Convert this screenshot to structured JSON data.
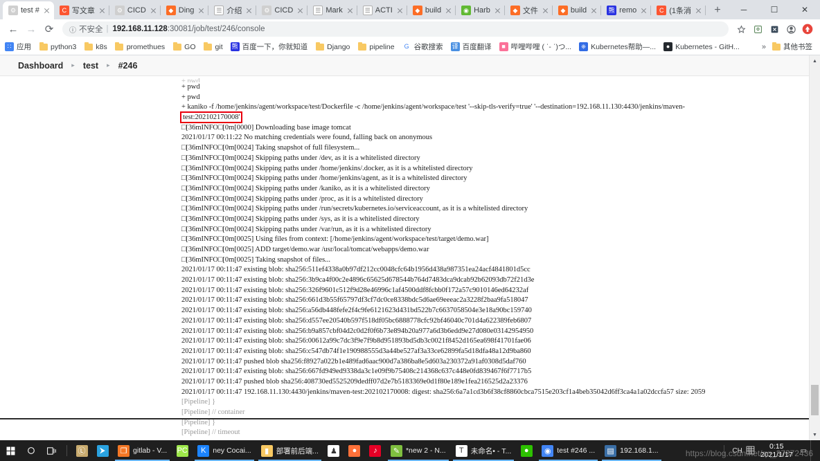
{
  "browser": {
    "tabs": [
      {
        "label": "test #",
        "icon": "jenkins-icon",
        "icon_color": "#cfcfcf",
        "glyph": "⚙",
        "active": true
      },
      {
        "label": "写文章",
        "icon": "csdn-icon",
        "icon_color": "#fc5531",
        "glyph": "C",
        "active": false
      },
      {
        "label": "CICD",
        "icon": "jenkins-icon",
        "icon_color": "#cfcfcf",
        "glyph": "⚙",
        "active": false
      },
      {
        "label": "Ding",
        "icon": "gitlab-icon",
        "icon_color": "#fc6d26",
        "glyph": "◆",
        "active": false
      },
      {
        "label": "介绍",
        "icon": "doc-icon",
        "icon_color": "#ffffff",
        "glyph": "☰",
        "active": false
      },
      {
        "label": "CICD",
        "icon": "jenkins-icon",
        "icon_color": "#cfcfcf",
        "glyph": "⚙",
        "active": false
      },
      {
        "label": "Mark",
        "icon": "doc-icon",
        "icon_color": "#ffffff",
        "glyph": "☰",
        "active": false
      },
      {
        "label": "ACTI",
        "icon": "doc-icon",
        "icon_color": "#ffffff",
        "glyph": "☰",
        "active": false
      },
      {
        "label": "build",
        "icon": "gitlab-icon",
        "icon_color": "#fc6d26",
        "glyph": "◆",
        "active": false
      },
      {
        "label": "Harb",
        "icon": "harbor-icon",
        "icon_color": "#60b932",
        "glyph": "◉",
        "active": false
      },
      {
        "label": "文件",
        "icon": "gitlab-icon",
        "icon_color": "#fc6d26",
        "glyph": "◆",
        "active": false
      },
      {
        "label": "build",
        "icon": "gitlab-icon",
        "icon_color": "#fc6d26",
        "glyph": "◆",
        "active": false
      },
      {
        "label": "remo",
        "icon": "baidu-icon",
        "icon_color": "#2932e1",
        "glyph": "熊",
        "active": false
      },
      {
        "label": "(1条消",
        "icon": "csdn-icon",
        "icon_color": "#fc5531",
        "glyph": "C",
        "active": false
      }
    ],
    "newtab_label": "+",
    "window_controls": {
      "minimize": "─",
      "maximize": "☐",
      "close": "✕"
    },
    "nav": {
      "back": "←",
      "forward": "→",
      "reload": "⟳"
    },
    "omnibox": {
      "security_icon": "ⓘ",
      "security_label": "不安全",
      "separator": "|",
      "host": "192.168.11.128",
      "path": ":30081/job/test/246/console"
    },
    "toolbar_icons": [
      {
        "name": "bookmark-star-icon",
        "glyph": "☆"
      },
      {
        "name": "extension-icon",
        "glyph": "⎇"
      },
      {
        "name": "extension2-icon",
        "glyph": "☒"
      },
      {
        "name": "profile-icon",
        "glyph": "●"
      },
      {
        "name": "update-icon",
        "glyph": "●"
      }
    ],
    "bookmarks": [
      {
        "label": "应用",
        "icon": "apps-grid-icon"
      },
      {
        "label": "python3",
        "icon": "folder-icon"
      },
      {
        "label": "k8s",
        "icon": "folder-icon"
      },
      {
        "label": "promethues",
        "icon": "folder-icon"
      },
      {
        "label": "GO",
        "icon": "folder-icon"
      },
      {
        "label": "git",
        "icon": "folder-icon"
      },
      {
        "label": "百度一下，你就知道",
        "icon": "baidu-icon"
      },
      {
        "label": "Django",
        "icon": "folder-icon"
      },
      {
        "label": "pipeline",
        "icon": "folder-icon"
      },
      {
        "label": "谷歌搜索",
        "icon": "google-icon"
      },
      {
        "label": "百度翻译",
        "icon": "translate-icon"
      },
      {
        "label": "哔哩哔哩 ( ˈ- ˈ)つ...",
        "icon": "bilibili-icon"
      },
      {
        "label": "Kubernetes帮助—...",
        "icon": "kubernetes-icon"
      },
      {
        "label": "Kubernetes - GitH...",
        "icon": "github-icon"
      }
    ],
    "bookmarks_overflow": "»",
    "other_bookmarks": {
      "label": "其他书签",
      "icon": "folder-icon"
    }
  },
  "jenkins": {
    "breadcrumb": [
      {
        "label": "Dashboard"
      },
      {
        "label": "test"
      },
      {
        "label": "#246"
      }
    ],
    "breadcrumb_separator": "▸",
    "highlight_color": "#e8000d",
    "console_lines": [
      {
        "text": "+ pwd",
        "style": "cut"
      },
      {
        "text": "+ pwd",
        "style": "normal"
      },
      {
        "text": "+ pwd",
        "style": "normal"
      },
      {
        "text": "+ kaniko -f /home/jenkins/agent/workspace/test/Dockerfile -c /home/jenkins/agent/workspace/test '--skip-tls-verify=true' '--destination=192.168.11.130:4430/jenkins/maven-",
        "style": "normal"
      },
      {
        "text": "test:202102170008'",
        "style": "highlight"
      },
      {
        "text": "□[36mINFO□[0m[0000] Downloading base image tomcat",
        "style": "normal"
      },
      {
        "text": "2021/01/17 00:11:22 No matching credentials were found, falling back on anonymous",
        "style": "normal"
      },
      {
        "text": "□[36mINFO□[0m[0024] Taking snapshot of full filesystem...",
        "style": "normal"
      },
      {
        "text": "□[36mINFO□[0m[0024] Skipping paths under /dev, as it is a whitelisted directory",
        "style": "normal"
      },
      {
        "text": "□[36mINFO□[0m[0024] Skipping paths under /home/jenkins/.docker, as it is a whitelisted directory",
        "style": "normal"
      },
      {
        "text": "□[36mINFO□[0m[0024] Skipping paths under /home/jenkins/agent, as it is a whitelisted directory",
        "style": "normal"
      },
      {
        "text": "□[36mINFO□[0m[0024] Skipping paths under /kaniko, as it is a whitelisted directory",
        "style": "normal"
      },
      {
        "text": "□[36mINFO□[0m[0024] Skipping paths under /proc, as it is a whitelisted directory",
        "style": "normal"
      },
      {
        "text": "□[36mINFO□[0m[0024] Skipping paths under /run/secrets/kubernetes.io/serviceaccount, as it is a whitelisted directory",
        "style": "normal"
      },
      {
        "text": "□[36mINFO□[0m[0024] Skipping paths under /sys, as it is a whitelisted directory",
        "style": "normal"
      },
      {
        "text": "□[36mINFO□[0m[0024] Skipping paths under /var/run, as it is a whitelisted directory",
        "style": "normal"
      },
      {
        "text": "□[36mINFO□[0m[0025] Using files from context: [/home/jenkins/agent/workspace/test/target/demo.war]",
        "style": "normal"
      },
      {
        "text": "□[36mINFO□[0m[0025] ADD target/demo.war /usr/local/tomcat/webapps/demo.war",
        "style": "normal"
      },
      {
        "text": "□[36mINFO□[0m[0025] Taking snapshot of files...",
        "style": "normal"
      },
      {
        "text": "2021/01/17 00:11:47 existing blob: sha256:511ef4338a0b97df212cc0048cfc64b1956d438a987351ea24acf4841801d5cc",
        "style": "normal"
      },
      {
        "text": "2021/01/17 00:11:47 existing blob: sha256:3b9ca4f00c2e4896c65625d678544b764d7483dca9dcab92b62093db72f21d3e",
        "style": "normal"
      },
      {
        "text": "2021/01/17 00:11:47 existing blob: sha256:326f9601c512f9d28e46996c1af4500ddf8fcbb0f172a57c9010146ed64232af",
        "style": "normal"
      },
      {
        "text": "2021/01/17 00:11:47 existing blob: sha256:661d3b55f65797df3cf7dc0ce8338bdc5d6ae69eeeac2a3228f2baa9fa518047",
        "style": "normal"
      },
      {
        "text": "2021/01/17 00:11:47 existing blob: sha256:a56db448fefe2f4c9fe6121623d431bd522b7c6637058504e3e18a90bc159740",
        "style": "normal"
      },
      {
        "text": "2021/01/17 00:11:47 existing blob: sha256:d557ee20540b597f518df05bc6888778cfc92bf46040c701d4a622389feb6807",
        "style": "normal"
      },
      {
        "text": "2021/01/17 00:11:47 existing blob: sha256:b9a857cbf04d2c0d2f0f6b73e894b20a977a6d3b6edd9e27d080e03142954950",
        "style": "normal"
      },
      {
        "text": "2021/01/17 00:11:47 existing blob: sha256:00612a99c7dc3f9e7f9b8d951893bd5db3c0021f8452d165ea698f41701fae06",
        "style": "normal"
      },
      {
        "text": "2021/01/17 00:11:47 existing blob: sha256:c547db74f1e190988555d3a44be527af3a33ce62899fa5d18dfa48a12d9ba860",
        "style": "normal"
      },
      {
        "text": "2021/01/17 00:11:47 pushed blob sha256:f8927a022b1e489fad6aac900d7a386ba8e5d603a230372a91af0308d5daf760",
        "style": "normal"
      },
      {
        "text": "2021/01/17 00:11:47 existing blob: sha256:667fd949ed9338da3c1e09f9b75408c214368c637c448e0fd839467f6f7717b5",
        "style": "normal"
      },
      {
        "text": "2021/01/17 00:11:47 pushed blob sha256:408730ed5525209dedff07d2e7b5183369e0d1f80e189e1fea216525d2a23376",
        "style": "normal"
      },
      {
        "text": "2021/01/17 00:11:47 192.168.11.130:4430/jenkins/maven-test:202102170008: digest: sha256:6a7a1cd3b6f38cf8860cbca7515e203cf1a4beb35042d6ff3ca4a1a02dccfa57 size: 2059",
        "style": "normal"
      },
      {
        "text": "[Pipeline] }",
        "style": "dim"
      },
      {
        "text": "[Pipeline] // container",
        "style": "dim"
      },
      {
        "text": "[Pipeline] }",
        "style": "dim"
      },
      {
        "text": "[Pipeline] // timeout",
        "style": "dim"
      }
    ]
  },
  "scrollbar": {
    "up_arrow": "▲",
    "down_arrow": "▼"
  },
  "taskbar": {
    "start": {
      "name": "start-button",
      "glyph": "⊞"
    },
    "search": {
      "name": "search-button",
      "glyph": "○"
    },
    "taskview": {
      "name": "task-view-button",
      "glyph": "❑"
    },
    "pinned": [
      {
        "label": "",
        "icon": "lol-icon",
        "color": "#c8aa6e",
        "glyph": "Ⓛ"
      },
      {
        "label": "",
        "icon": "vscode-icon",
        "color": "#2aa2e0",
        "glyph": "⮞"
      }
    ],
    "windows": [
      {
        "label": "gitlab - V...",
        "icon": "vmware-icon",
        "color": "#f37726",
        "glyph": "❐",
        "open": true
      },
      {
        "label": "",
        "icon": "pycharm-icon",
        "color": "#9ee84a",
        "glyph": "PC",
        "open": false
      },
      {
        "label": "ney Cocai...",
        "icon": "kuwo-icon",
        "color": "#1c84ff",
        "glyph": "K",
        "open": true
      },
      {
        "label": "部署前后端...",
        "icon": "folder-icon",
        "color": "#f8c963",
        "glyph": "▮",
        "open": true
      },
      {
        "label": "",
        "icon": "qq-icon",
        "color": "#ffffff",
        "glyph": "♟",
        "open": false
      },
      {
        "label": "",
        "icon": "firefox-icon",
        "color": "#ff7139",
        "glyph": "●",
        "open": false
      },
      {
        "label": "",
        "icon": "netease-music-icon",
        "color": "#e60026",
        "glyph": "♪",
        "open": false
      },
      {
        "label": "*new 2 - N...",
        "icon": "notepadpp-icon",
        "color": "#7fbf3f",
        "glyph": "✎",
        "open": true
      },
      {
        "label": "未命名• - T...",
        "icon": "typora-icon",
        "color": "#ffffff",
        "glyph": "T",
        "open": true
      },
      {
        "label": "",
        "icon": "wechat-icon",
        "color": "#2dc100",
        "glyph": "●",
        "open": false
      },
      {
        "label": "test #246 ...",
        "icon": "chrome-icon",
        "color": "#4285f4",
        "glyph": "◉",
        "open": true
      },
      {
        "label": "192.168.1...",
        "icon": "xshell-icon",
        "color": "#3a6ea5",
        "glyph": "▤",
        "open": true
      }
    ],
    "tray": {
      "ime": "CH",
      "ime_icon": "ime-keyboard-icon",
      "time": "0:15",
      "date": "2021/1/17",
      "notification_icon": "▭"
    }
  },
  "watermark": {
    "line1": "https://blog.csdn.net/qq_37372436",
    "line2": ""
  }
}
